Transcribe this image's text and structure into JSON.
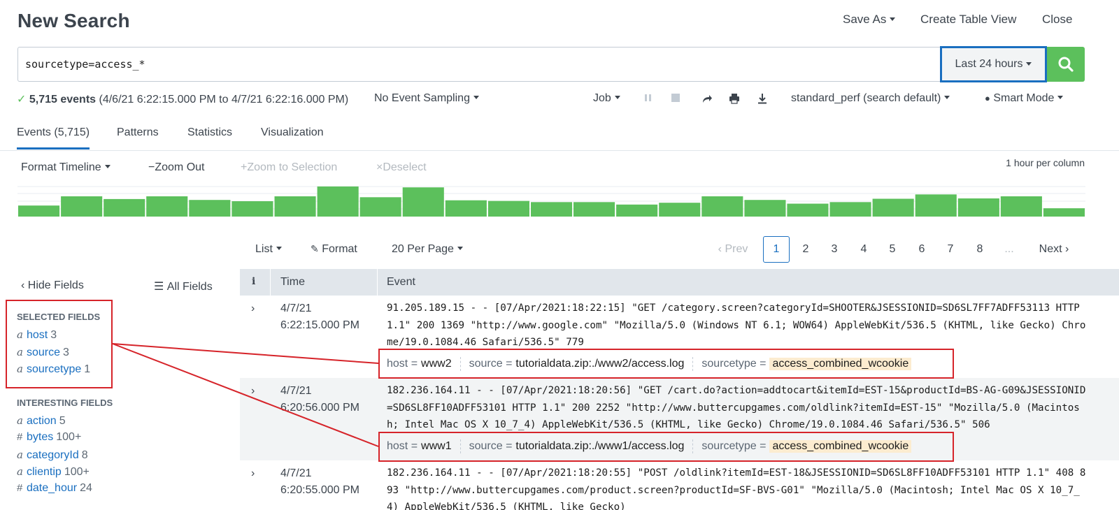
{
  "header": {
    "title": "New Search",
    "save_as": "Save As",
    "create_table_view": "Create Table View",
    "close": "Close"
  },
  "search": {
    "query": "sourcetype=access_*",
    "time_range": "Last 24 hours"
  },
  "status": {
    "event_count": "5,715 events",
    "range": "(4/6/21 6:22:15.000 PM to 4/7/21 6:22:16.000 PM)",
    "sampling": "No Event Sampling",
    "job": "Job",
    "perf": "standard_perf (search default)",
    "mode": "Smart Mode"
  },
  "tabs": [
    {
      "label": "Events (5,715)",
      "active": true
    },
    {
      "label": "Patterns"
    },
    {
      "label": "Statistics"
    },
    {
      "label": "Visualization"
    }
  ],
  "timeline": {
    "format": "Format Timeline",
    "zoom_out": "Zoom Out",
    "zoom_to_selection": "Zoom to Selection",
    "deselect": "Deselect",
    "scale_label": "1 hour per column",
    "bar_color": "#5cc05c",
    "bars": [
      0.36,
      0.66,
      0.57,
      0.66,
      0.54,
      0.5,
      0.66,
      0.98,
      0.63,
      0.95,
      0.53,
      0.51,
      0.47,
      0.47,
      0.39,
      0.45,
      0.66,
      0.54,
      0.42,
      0.47,
      0.58,
      0.72,
      0.59,
      0.66,
      0.27
    ]
  },
  "list_controls": {
    "list": "List",
    "format": "Format",
    "per_page": "20 Per Page",
    "prev": "Prev",
    "next": "Next",
    "pages": [
      "1",
      "2",
      "3",
      "4",
      "5",
      "6",
      "7",
      "8"
    ],
    "ellipsis": "...",
    "current_page": "1"
  },
  "sidebar": {
    "hide_fields": "Hide Fields",
    "all_fields": "All Fields",
    "selected_title": "SELECTED FIELDS",
    "selected": [
      {
        "type": "a",
        "name": "host",
        "count": "3"
      },
      {
        "type": "a",
        "name": "source",
        "count": "3"
      },
      {
        "type": "a",
        "name": "sourcetype",
        "count": "1"
      }
    ],
    "interesting_title": "INTERESTING FIELDS",
    "interesting": [
      {
        "type": "a",
        "name": "action",
        "count": "5"
      },
      {
        "type": "#",
        "name": "bytes",
        "count": "100+"
      },
      {
        "type": "a",
        "name": "categoryId",
        "count": "8"
      },
      {
        "type": "a",
        "name": "clientip",
        "count": "100+"
      },
      {
        "type": "#",
        "name": "date_hour",
        "count": "24"
      }
    ]
  },
  "table": {
    "col_i": "i",
    "col_time": "Time",
    "col_event": "Event",
    "rows": [
      {
        "date": "4/7/21",
        "time": "6:22:15.000 PM",
        "raw": "91.205.189.15 - - [07/Apr/2021:18:22:15] \"GET /category.screen?categoryId=SHOOTER&JSESSIONID=SD6SL7FF7ADFF53113 HTTP 1.1\" 200 1369 \"http://www.google.com\" \"Mozilla/5.0 (Windows NT 6.1; WOW64) AppleWebKit/536.5 (KHTML, like Gecko) Chrome/19.0.1084.46 Safari/536.5\" 779",
        "host_k": "host =",
        "host_v": "www2",
        "source_k": "source =",
        "source_v": "tutorialdata.zip:./www2/access.log",
        "st_k": "sourcetype =",
        "st_v": "access_combined_wcookie"
      },
      {
        "date": "4/7/21",
        "time": "6:20:56.000 PM",
        "raw": "182.236.164.11 - - [07/Apr/2021:18:20:56] \"GET /cart.do?action=addtocart&itemId=EST-15&productId=BS-AG-G09&JSESSIONID=SD6SL8FF10ADFF53101 HTTP 1.1\" 200 2252 \"http://www.buttercupgames.com/oldlink?itemId=EST-15\" \"Mozilla/5.0 (Macintosh; Intel Mac OS X 10_7_4) AppleWebKit/536.5 (KHTML, like Gecko) Chrome/19.0.1084.46 Safari/536.5\" 506",
        "host_k": "host =",
        "host_v": "www1",
        "source_k": "source =",
        "source_v": "tutorialdata.zip:./www1/access.log",
        "st_k": "sourcetype =",
        "st_v": "access_combined_wcookie"
      },
      {
        "date": "4/7/21",
        "time": "6:20:55.000 PM",
        "raw": "182.236.164.11 - - [07/Apr/2021:18:20:55] \"POST /oldlink?itemId=EST-18&JSESSIONID=SD6SL8FF10ADFF53101 HTTP 1.1\" 408 893 \"http://www.buttercupgames.com/product.screen?productId=SF-BVS-G01\" \"Mozilla/5.0 (Macintosh; Intel Mac OS X 10_7_4) AppleWebKit/536.5 (KHTML, like Gecko)"
      }
    ]
  },
  "colors": {
    "accent": "#1a6fc0",
    "success": "#5cc05c",
    "annotation": "#d6242a",
    "highlight": "#fcecd0"
  }
}
